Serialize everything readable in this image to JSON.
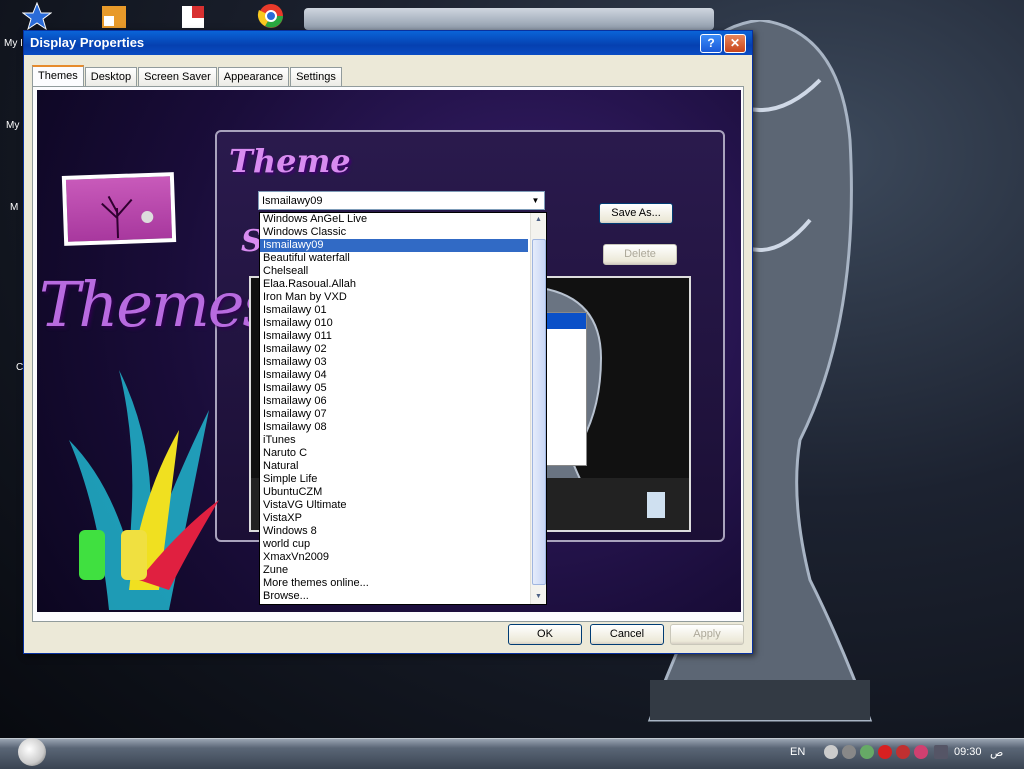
{
  "desktop": {
    "icon_labels": [
      "My I",
      "My",
      "M",
      "C"
    ]
  },
  "window": {
    "title": "Display Properties",
    "help_label": "?",
    "close_label": "✕"
  },
  "tabs": [
    "Themes",
    "Desktop",
    "Screen Saver",
    "Appearance",
    "Settings"
  ],
  "art": {
    "theme_heading": "Theme",
    "themes_heading": "Themes",
    "partial_s": "S"
  },
  "combo": {
    "selected": "Ismailawy09",
    "arrow": "▼"
  },
  "theme_list": [
    "Windows AnGeL Live",
    "Windows Classic",
    "Ismailawy09",
    "Beautiful waterfall",
    "Chelseall",
    "Elaa.Rasoual.Allah",
    "Iron Man by VXD",
    "Ismailawy 01",
    "Ismailawy 010",
    "Ismailawy 011",
    "Ismailawy 02",
    "Ismailawy 03",
    "Ismailawy 04",
    "Ismailawy 05",
    "Ismailawy 06",
    "Ismailawy 07",
    "Ismailawy 08",
    "iTunes",
    "Naruto C",
    "Natural",
    "Simple Life",
    "UbuntuCZM",
    "VistaVG Ultimate",
    "VistaXP",
    "Windows 8",
    "world cup",
    "XmaxVn2009",
    "Zune",
    "More themes online...",
    "Browse..."
  ],
  "buttons": {
    "save_as": "Save As...",
    "delete": "Delete",
    "ok": "OK",
    "cancel": "Cancel",
    "apply": "Apply"
  },
  "taskbar": {
    "lang": "EN",
    "time": "09:30",
    "ampm": "ص"
  },
  "colors": {
    "selection": "#316ac5",
    "titlebar": "#0a64d8"
  }
}
